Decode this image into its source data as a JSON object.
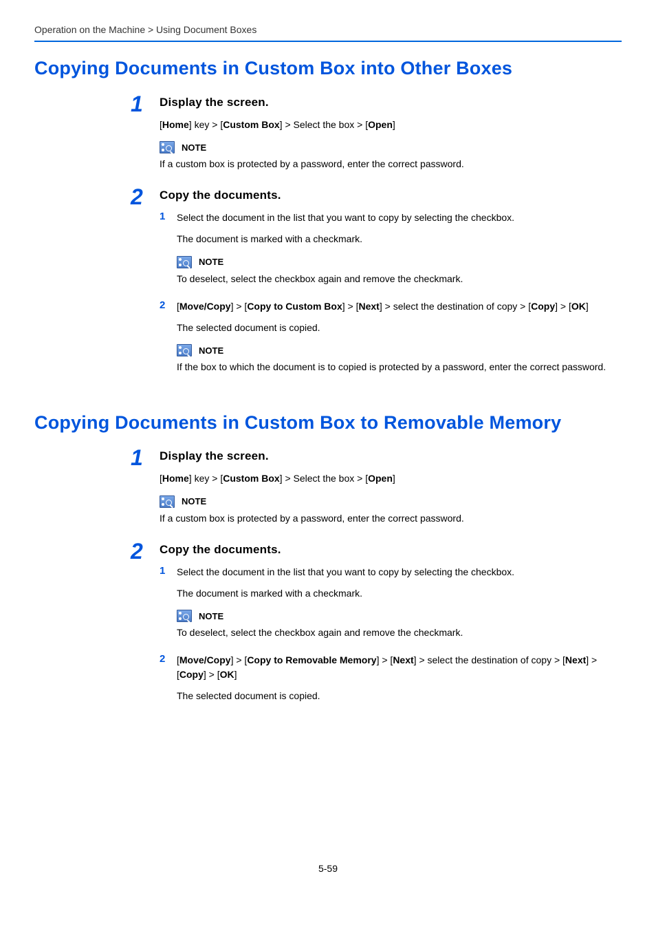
{
  "breadcrumb": "Operation on the Machine > Using Document Boxes",
  "section1": {
    "title": "Copying Documents in Custom Box into Other Boxes",
    "step1": {
      "num": "1",
      "title": "Display the screen.",
      "path_pre": "[",
      "path_1": "Home",
      "path_mid1": "] key > [",
      "path_2": "Custom Box",
      "path_mid2": "] > Select the box > [",
      "path_3": "Open",
      "path_post": "]",
      "note_label": "NOTE",
      "note_text": "If a custom box is protected by a password, enter the correct password."
    },
    "step2": {
      "num": "2",
      "title": "Copy the documents.",
      "sub1": {
        "num": "1",
        "text": "Select the document in the list that you want to copy by selecting the checkbox.",
        "para": "The document is marked with a checkmark.",
        "note_label": "NOTE",
        "note_text": "To deselect, select the checkbox again and remove the checkmark."
      },
      "sub2": {
        "num": "2",
        "p1": "[",
        "b1": "Move/Copy",
        "p2": "] > [",
        "b2": "Copy to Custom Box",
        "p3": "] > [",
        "b3": "Next",
        "p4": "] > select the destination of copy > [",
        "b4": "Copy",
        "p5": "] > [",
        "b5": "OK",
        "p6": "]",
        "para": "The selected document is copied.",
        "note_label": "NOTE",
        "note_text": "If the box to which the document is to copied is protected by a password, enter the correct password."
      }
    }
  },
  "section2": {
    "title": "Copying Documents in Custom Box to Removable Memory",
    "step1": {
      "num": "1",
      "title": "Display the screen.",
      "path_pre": "[",
      "path_1": "Home",
      "path_mid1": "] key > [",
      "path_2": "Custom Box",
      "path_mid2": "] > Select the box > [",
      "path_3": "Open",
      "path_post": "]",
      "note_label": "NOTE",
      "note_text": "If a custom box is protected by a password, enter the correct password."
    },
    "step2": {
      "num": "2",
      "title": "Copy the documents.",
      "sub1": {
        "num": "1",
        "text": "Select the document in the list that you want to copy by selecting the checkbox.",
        "para": "The document is marked with a checkmark.",
        "note_label": "NOTE",
        "note_text": "To deselect, select the checkbox again and remove the checkmark."
      },
      "sub2": {
        "num": "2",
        "p1": "[",
        "b1": "Move/Copy",
        "p2": "] > [",
        "b2": "Copy to Removable Memory",
        "p3": "] > [",
        "b3": "Next",
        "p4": "] > select the destination of copy > [",
        "b4": "Next",
        "p5": "] > [",
        "b5": "Copy",
        "p6": "] > [",
        "b6": "OK",
        "p7": "]",
        "para": "The selected document is copied."
      }
    }
  },
  "page_number": "5-59"
}
